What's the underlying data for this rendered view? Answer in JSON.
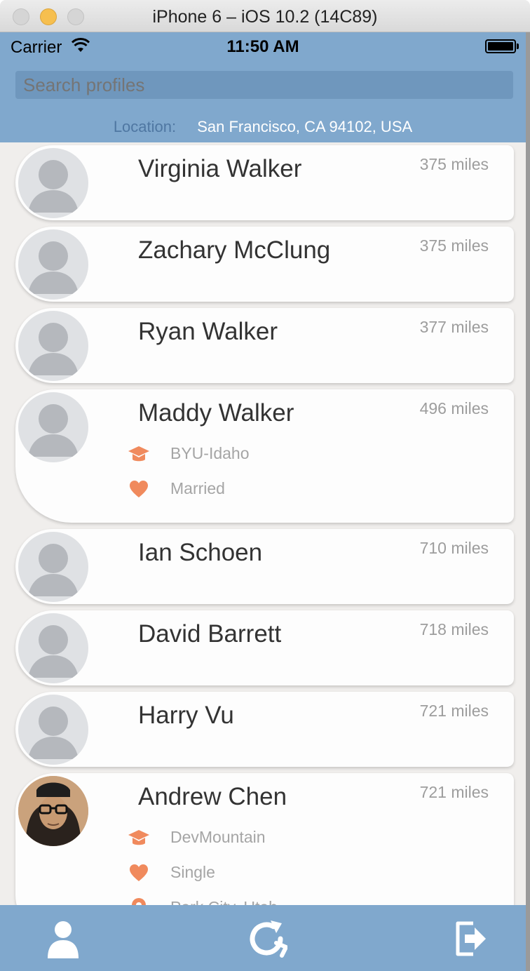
{
  "window": {
    "title": "iPhone 6 – iOS 10.2 (14C89)"
  },
  "status_bar": {
    "carrier": "Carrier",
    "time": "11:50 AM"
  },
  "search": {
    "placeholder": "Search profiles"
  },
  "location": {
    "label": "Location:",
    "value": "San Francisco, CA 94102, USA"
  },
  "profiles": [
    {
      "name": "Virginia Walker",
      "distance": "375 miles"
    },
    {
      "name": "Zachary McClung",
      "distance": "375 miles"
    },
    {
      "name": "Ryan Walker",
      "distance": "377 miles"
    },
    {
      "name": "Maddy Walker",
      "distance": "496 miles",
      "school": "BYU-Idaho",
      "relationship": "Married"
    },
    {
      "name": "Ian Schoen",
      "distance": "710 miles"
    },
    {
      "name": "David Barrett",
      "distance": "718 miles"
    },
    {
      "name": "Harry Vu",
      "distance": "721 miles"
    },
    {
      "name": "Andrew Chen",
      "distance": "721 miles",
      "school": "DevMountain",
      "relationship": "Single",
      "hometown": "Park City, Utah"
    }
  ],
  "tabs": [
    {
      "icon": "person-icon"
    },
    {
      "icon": "refresh-icon"
    },
    {
      "icon": "logout-icon"
    }
  ],
  "colors": {
    "header": "#80a8cd",
    "accent": "#f08a5d",
    "placeholder_avatar": "#dfe1e4"
  }
}
